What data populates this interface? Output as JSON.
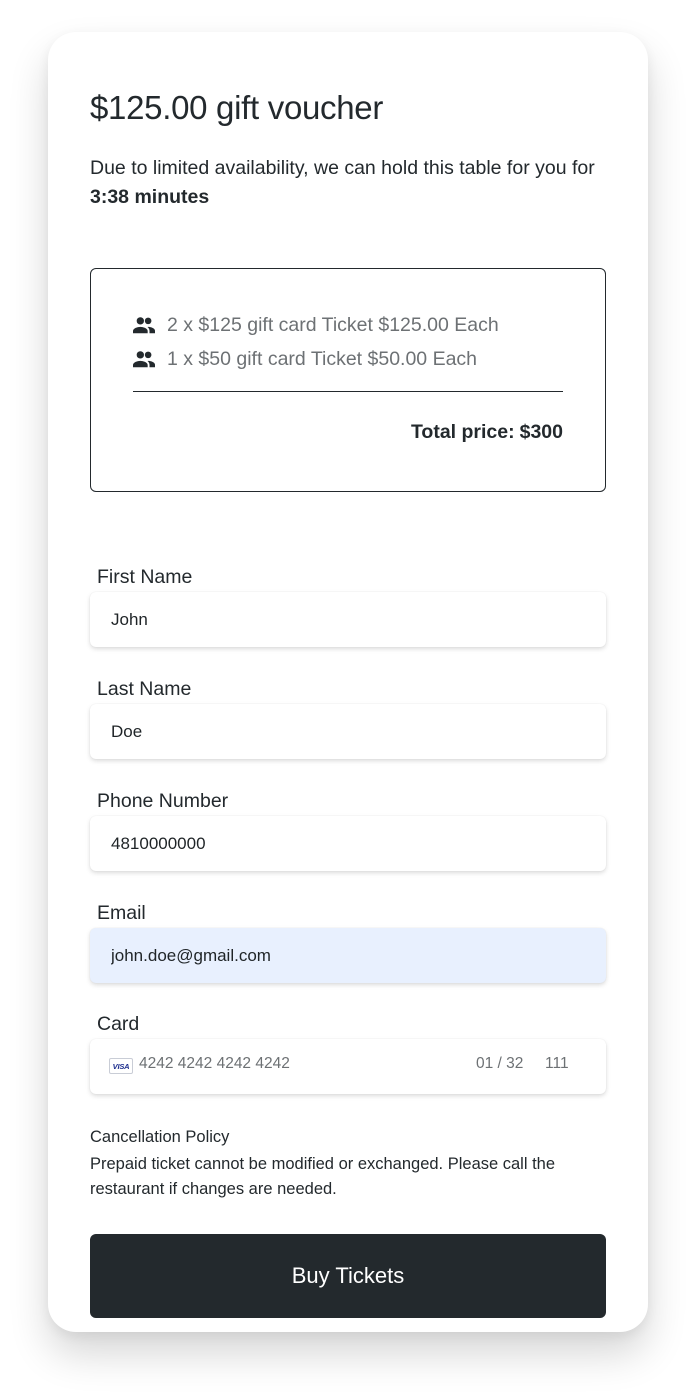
{
  "header": {
    "title": "$125.00 gift voucher",
    "hold_prefix": "Due to limited availability, we can hold this table for you for ",
    "hold_time": "3:38 minutes"
  },
  "summary": {
    "tickets": [
      {
        "icon": "people-icon",
        "text": "2 x $125 gift card Ticket $125.00 Each"
      },
      {
        "icon": "people-icon",
        "text": "1 x $50 gift card Ticket $50.00 Each"
      }
    ],
    "total_label": "Total price:",
    "total_value": "$300"
  },
  "form": {
    "first_name": {
      "label": "First Name",
      "value": "John"
    },
    "last_name": {
      "label": "Last Name",
      "value": "Doe"
    },
    "phone": {
      "label": "Phone Number",
      "value": "4810000000"
    },
    "email": {
      "label": "Email",
      "value": "john.doe@gmail.com"
    },
    "card": {
      "label": "Card",
      "brand": "VISA",
      "number": "4242 4242 4242 4242",
      "expiry": "01 / 32",
      "cvc": "111"
    }
  },
  "policy": {
    "title": "Cancellation Policy",
    "text": "Prepaid ticket cannot be modified or exchanged. Please call the restaurant if changes are needed."
  },
  "actions": {
    "buy_label": "Buy Tickets"
  },
  "colors": {
    "text": "#23292d",
    "muted": "#6d7174",
    "button_bg": "#23292d",
    "autofill_bg": "#e8f0fe"
  }
}
